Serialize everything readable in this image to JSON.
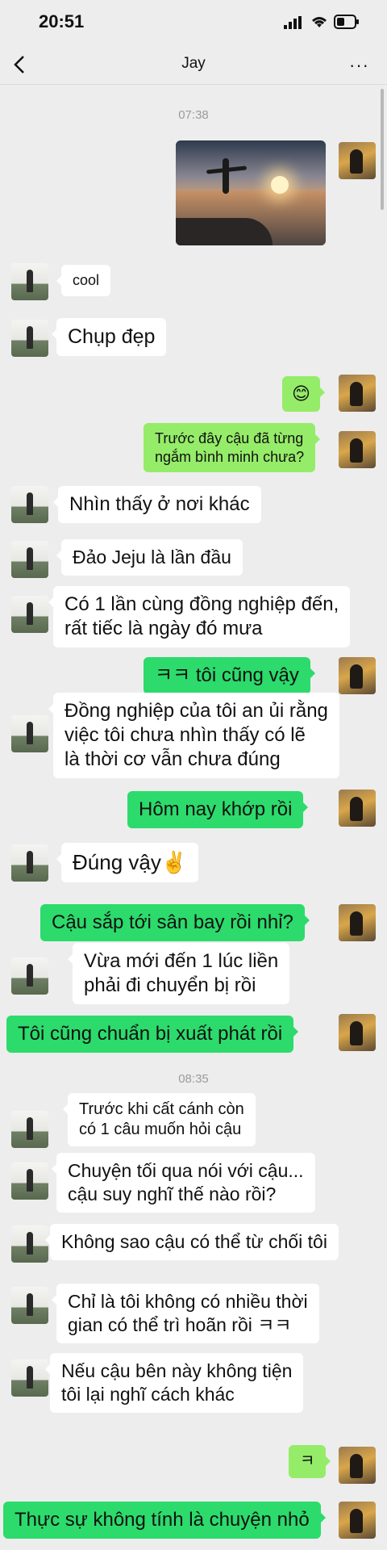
{
  "status_bar": {
    "time": "20:51",
    "icons": [
      "signal-icon",
      "wifi-icon",
      "battery-icon"
    ]
  },
  "header": {
    "title": "Jay",
    "back_icon": "back-arrow-icon",
    "more_icon": "more-icon",
    "more_label": "···"
  },
  "timestamps": {
    "first": "07:38",
    "second": "08:35"
  },
  "messages": [
    {
      "from": "me",
      "type": "image",
      "description_icon": "photo"
    },
    {
      "from": "them",
      "text": "cool"
    },
    {
      "from": "them",
      "text": "Chụp đẹp"
    },
    {
      "from": "me",
      "text": "😊"
    },
    {
      "from": "me",
      "lines": [
        "Trước đây cậu đã từng",
        "ngắm bình minh chưa?"
      ]
    },
    {
      "from": "them",
      "text": "Nhìn thấy ở nơi khác"
    },
    {
      "from": "them",
      "text": "Đảo Jeju là lần đầu"
    },
    {
      "from": "them",
      "lines": [
        "Có 1 lần cùng đồng nghiệp đến,",
        "rất tiếc là ngày đó mưa"
      ]
    },
    {
      "from": "me",
      "text": "ㅋㅋ tôi cũng vậy"
    },
    {
      "from": "them",
      "lines": [
        "Đồng nghiệp của tôi an ủi rằng",
        "việc tôi chưa nhìn thấy có lẽ",
        "là thời cơ vẫn chưa đúng"
      ]
    },
    {
      "from": "me",
      "text": "Hôm nay khớp rồi"
    },
    {
      "from": "them",
      "text": "Đúng vậy✌️"
    },
    {
      "from": "me",
      "text": "Cậu sắp tới sân bay rồi nhỉ?"
    },
    {
      "from": "them",
      "lines": [
        "Vừa mới đến 1 lúc liền",
        "phải đi chuyển bị rồi"
      ]
    },
    {
      "from": "me",
      "text": "Tôi cũng chuẩn bị xuất phát rồi"
    },
    {
      "from": "them",
      "lines": [
        "Trước khi cất cánh còn",
        "có 1 câu muốn hỏi cậu"
      ]
    },
    {
      "from": "them",
      "lines": [
        "Chuyện tối qua nói với cậu...",
        "cậu suy nghĩ thế nào rồi?"
      ]
    },
    {
      "from": "them",
      "text": "Không sao cậu có thể từ chối tôi"
    },
    {
      "from": "them",
      "lines": [
        "Chỉ là tôi không có nhiều thời",
        "gian có thể trì hoãn rồi ㅋㅋ"
      ]
    },
    {
      "from": "them",
      "lines": [
        "Nếu cậu bên này không tiện",
        "tôi lại nghĩ cách khác"
      ]
    },
    {
      "from": "me",
      "text": "ㅋ"
    },
    {
      "from": "me",
      "text": "Thực sự không tính là chuyện nhỏ"
    }
  ],
  "colors": {
    "background": "#ededed",
    "incoming_bubble": "#ffffff",
    "outgoing_bubble": "#95ec69",
    "outgoing_bright": "#2cdb6c",
    "timestamp": "#9b9b9b"
  }
}
